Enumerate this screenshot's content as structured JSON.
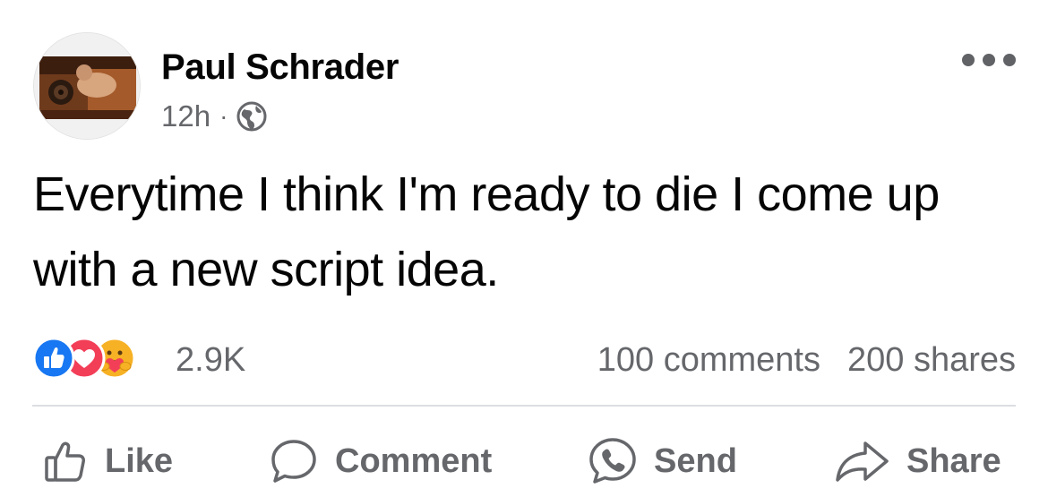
{
  "post": {
    "author": "Paul Schrader",
    "time": "12h",
    "separator": "·",
    "privacy_icon": "globe-icon",
    "text": "Everytime I think I'm ready to die I come up with a new script idea.",
    "more_icon": "more-options-icon"
  },
  "reactions": {
    "icons": [
      "like-reaction-icon",
      "love-reaction-icon",
      "care-reaction-icon"
    ],
    "count": "2.9K",
    "comments": "100 comments",
    "shares": "200 shares"
  },
  "actions": {
    "like": "Like",
    "comment": "Comment",
    "send": "Send",
    "share": "Share"
  },
  "colors": {
    "text": "#050505",
    "secondary": "#65676b",
    "like_blue": "#1877f2",
    "love_red": "#f33e58",
    "care_yellow": "#f7b125",
    "divider": "#dcdee2"
  }
}
